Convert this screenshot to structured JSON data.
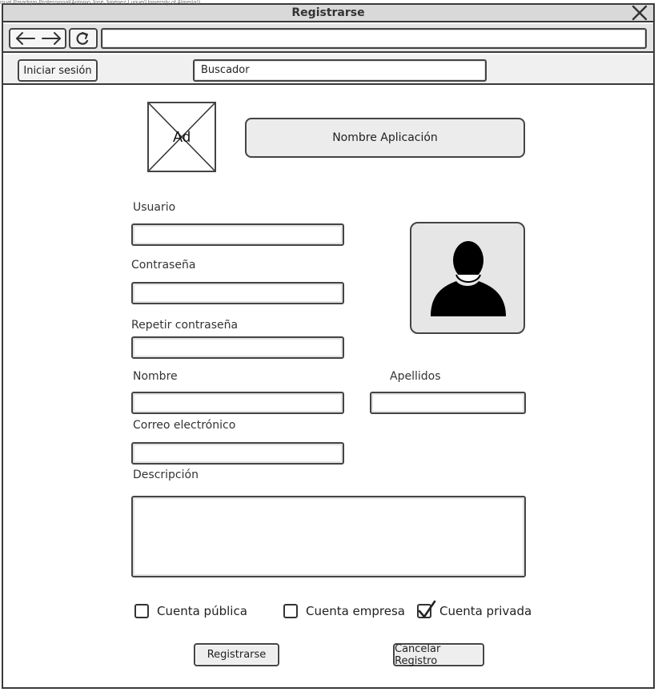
{
  "watermark": "isual Paradigm Professional(Antonio José Jiménez Luque(University of Almería))",
  "window": {
    "title": "Registrarse",
    "close_icon": "close-icon"
  },
  "browser": {
    "url": "",
    "back_icon": "arrow-left-icon",
    "forward_icon": "arrow-right-icon",
    "refresh_icon": "refresh-icon"
  },
  "toolbar": {
    "login_label": "Iniciar sesión",
    "search_text": "Buscador"
  },
  "ad": {
    "label": "Ad"
  },
  "app_name": "Nombre Aplicación",
  "form": {
    "usuario_label": "Usuario",
    "contrasena_label": "Contraseña",
    "repetir_label": "Repetir contraseña",
    "nombre_label": "Nombre",
    "apellidos_label": "Apellidos",
    "correo_label": "Correo electrónico",
    "descripcion_label": "Descripción",
    "usuario_value": "",
    "contrasena_value": "",
    "repetir_value": "",
    "nombre_value": "",
    "apellidos_value": "",
    "correo_value": "",
    "descripcion_value": ""
  },
  "account_types": [
    {
      "label": "Cuenta pública",
      "checked": false
    },
    {
      "label": "Cuenta empresa",
      "checked": false
    },
    {
      "label": "Cuenta privada",
      "checked": true
    }
  ],
  "buttons": {
    "register": "Registrarse",
    "cancel": "Cancelar Registro"
  },
  "colors": {
    "border": "#444444",
    "titlebar": "#d9d9d9",
    "avatar_bg": "#e6e6e6"
  }
}
